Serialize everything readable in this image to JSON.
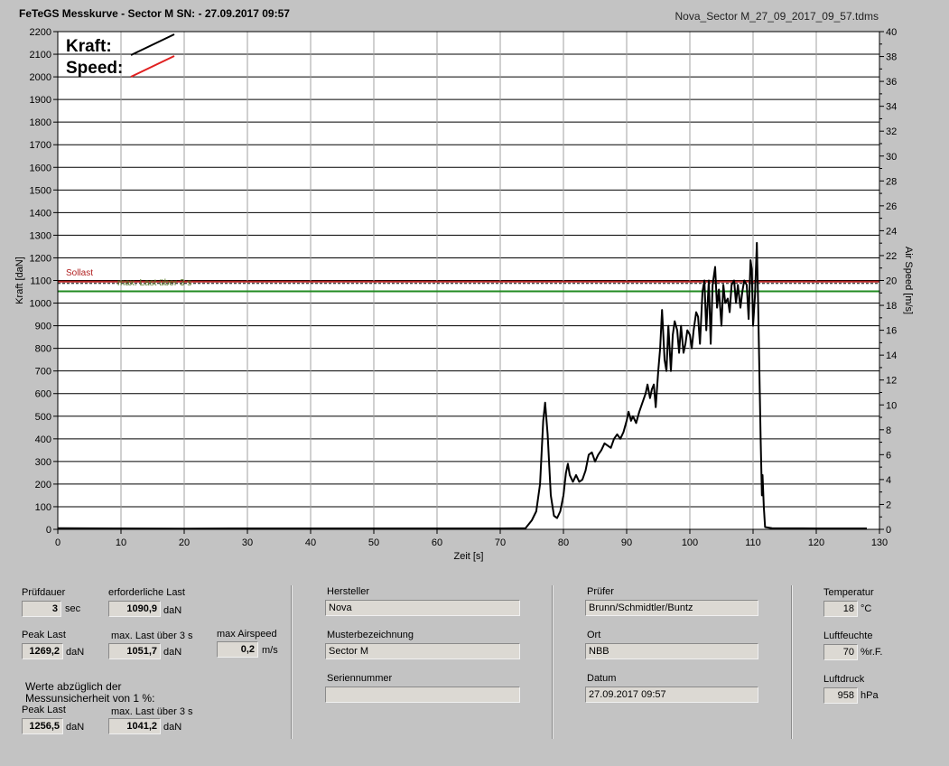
{
  "header": {
    "title": "FeTeGS Messkurve - Sector M  SN:  - 27.09.2017 09:57",
    "filename": "Nova_Sector M_27_09_2017_09_57.tdms"
  },
  "chart_data": {
    "type": "line",
    "xlabel": "Zeit [s]",
    "ylabel": "Kraft [daN]",
    "y2label": "Air Speed [m/s]",
    "xlim": [
      0,
      130
    ],
    "ylim": [
      0,
      2200
    ],
    "y2lim": [
      0,
      40
    ],
    "x_ticks": [
      0,
      10,
      20,
      30,
      40,
      50,
      60,
      70,
      80,
      90,
      100,
      110,
      120,
      130
    ],
    "y_ticks": [
      0,
      100,
      200,
      300,
      400,
      500,
      600,
      700,
      800,
      900,
      1000,
      1100,
      1200,
      1300,
      1400,
      1500,
      1600,
      1700,
      1800,
      1900,
      2000,
      2100,
      2200
    ],
    "y2_ticks": [
      0,
      2,
      4,
      6,
      8,
      10,
      12,
      14,
      16,
      18,
      20,
      22,
      24,
      26,
      28,
      30,
      32,
      34,
      36,
      38,
      40
    ],
    "grid": true,
    "legend": [
      {
        "name": "Kraft:",
        "color": "#000000"
      },
      {
        "name": "Speed:",
        "color": "#e02020"
      }
    ],
    "reference_lines": [
      {
        "name": "Sollast",
        "y": 1091,
        "color": "#b22222",
        "style": "solid"
      },
      {
        "name": "max. Last über  3 s",
        "y": 1052,
        "color": "#228b22",
        "style": "solid"
      }
    ],
    "series": [
      {
        "name": "Kraft:",
        "color": "#000000",
        "axis": "left",
        "points": [
          [
            0,
            5
          ],
          [
            10,
            4
          ],
          [
            20,
            3
          ],
          [
            30,
            4
          ],
          [
            40,
            4
          ],
          [
            50,
            4
          ],
          [
            60,
            4
          ],
          [
            70,
            4
          ],
          [
            74,
            5
          ],
          [
            75,
            40
          ],
          [
            75.7,
            80
          ],
          [
            76.3,
            200
          ],
          [
            76.8,
            480
          ],
          [
            77.1,
            560
          ],
          [
            77.5,
            420
          ],
          [
            78,
            150
          ],
          [
            78.5,
            60
          ],
          [
            79,
            50
          ],
          [
            79.5,
            80
          ],
          [
            80,
            150
          ],
          [
            80.4,
            250
          ],
          [
            80.7,
            290
          ],
          [
            81,
            240
          ],
          [
            81.5,
            210
          ],
          [
            82,
            240
          ],
          [
            82.5,
            210
          ],
          [
            83,
            220
          ],
          [
            83.5,
            260
          ],
          [
            84,
            330
          ],
          [
            84.5,
            340
          ],
          [
            85,
            300
          ],
          [
            85.5,
            330
          ],
          [
            86,
            350
          ],
          [
            86.5,
            380
          ],
          [
            87,
            370
          ],
          [
            87.5,
            360
          ],
          [
            88,
            400
          ],
          [
            88.5,
            420
          ],
          [
            89,
            400
          ],
          [
            89.5,
            430
          ],
          [
            90,
            480
          ],
          [
            90.3,
            520
          ],
          [
            90.7,
            480
          ],
          [
            91,
            500
          ],
          [
            91.5,
            470
          ],
          [
            92,
            520
          ],
          [
            92.5,
            560
          ],
          [
            93,
            600
          ],
          [
            93.3,
            640
          ],
          [
            93.7,
            580
          ],
          [
            94,
            620
          ],
          [
            94.3,
            640
          ],
          [
            94.6,
            540
          ],
          [
            95,
            700
          ],
          [
            95.3,
            800
          ],
          [
            95.6,
            970
          ],
          [
            96,
            750
          ],
          [
            96.3,
            700
          ],
          [
            96.6,
            900
          ],
          [
            97,
            700
          ],
          [
            97.3,
            860
          ],
          [
            97.6,
            920
          ],
          [
            98,
            880
          ],
          [
            98.3,
            780
          ],
          [
            98.6,
            900
          ],
          [
            99,
            780
          ],
          [
            99.3,
            820
          ],
          [
            99.6,
            880
          ],
          [
            100,
            860
          ],
          [
            100.3,
            800
          ],
          [
            100.6,
            880
          ],
          [
            101,
            960
          ],
          [
            101.3,
            940
          ],
          [
            101.6,
            820
          ],
          [
            102,
            1050
          ],
          [
            102.3,
            1100
          ],
          [
            102.6,
            880
          ],
          [
            103,
            1100
          ],
          [
            103.3,
            820
          ],
          [
            103.6,
            1080
          ],
          [
            104,
            1160
          ],
          [
            104.3,
            980
          ],
          [
            104.6,
            1060
          ],
          [
            105,
            900
          ],
          [
            105.3,
            1080
          ],
          [
            105.6,
            1000
          ],
          [
            106,
            1020
          ],
          [
            106.3,
            960
          ],
          [
            106.6,
            1080
          ],
          [
            107,
            1100
          ],
          [
            107.3,
            1000
          ],
          [
            107.6,
            1080
          ],
          [
            108,
            980
          ],
          [
            108.3,
            1050
          ],
          [
            108.6,
            1100
          ],
          [
            109,
            1080
          ],
          [
            109.3,
            930
          ],
          [
            109.6,
            1190
          ],
          [
            109.8,
            1150
          ],
          [
            110,
            900
          ],
          [
            110.3,
            1030
          ],
          [
            110.6,
            1266
          ],
          [
            110.8,
            1000
          ],
          [
            111,
            700
          ],
          [
            111.2,
            400
          ],
          [
            111.4,
            150
          ],
          [
            111.5,
            240
          ],
          [
            111.7,
            100
          ],
          [
            111.9,
            10
          ],
          [
            113,
            5
          ],
          [
            120,
            4
          ],
          [
            128,
            4
          ]
        ]
      },
      {
        "name": "Speed:",
        "color": "#e02020",
        "axis": "right",
        "points": [
          [
            0,
            0
          ],
          [
            128,
            0
          ]
        ]
      }
    ]
  },
  "panels": {
    "pruefdauer": {
      "label": "Prüfdauer",
      "value": "3",
      "unit": "sec"
    },
    "erforderliche_last": {
      "label": "erforderliche Last",
      "value": "1090,9",
      "unit": "daN"
    },
    "peak_last": {
      "label": "Peak Last",
      "value": "1269,2",
      "unit": "daN"
    },
    "max_last": {
      "label": "max. Last über  3 s",
      "value": "1051,7",
      "unit": "daN"
    },
    "max_airspeed": {
      "label": "max Airspeed",
      "value": "0,2",
      "unit": "m/s"
    },
    "werte_note_line1": "Werte abzüglich der",
    "werte_note_line2": "Messunsicherheit von 1   %:",
    "peak_last_2": {
      "label": "Peak Last",
      "value": "1256,5",
      "unit": "daN"
    },
    "max_last_2": {
      "label": "max. Last über  3 s",
      "value": "1041,2",
      "unit": "daN"
    },
    "hersteller": {
      "label": "Hersteller",
      "value": "Nova"
    },
    "musterbezeichnung": {
      "label": "Musterbezeichnung",
      "value": "Sector M"
    },
    "seriennummer": {
      "label": "Seriennummer",
      "value": ""
    },
    "pruefer": {
      "label": "Prüfer",
      "value": "Brunn/Schmidtler/Buntz"
    },
    "ort": {
      "label": "Ort",
      "value": "NBB"
    },
    "datum": {
      "label": "Datum",
      "value": "27.09.2017 09:57"
    },
    "temperatur": {
      "label": "Temperatur",
      "value": "18",
      "unit": "°C"
    },
    "luftfeuchte": {
      "label": "Luftfeuchte",
      "value": "70",
      "unit": "%r.F."
    },
    "luftdruck": {
      "label": "Luftdruck",
      "value": "958",
      "unit": "hPa"
    }
  }
}
